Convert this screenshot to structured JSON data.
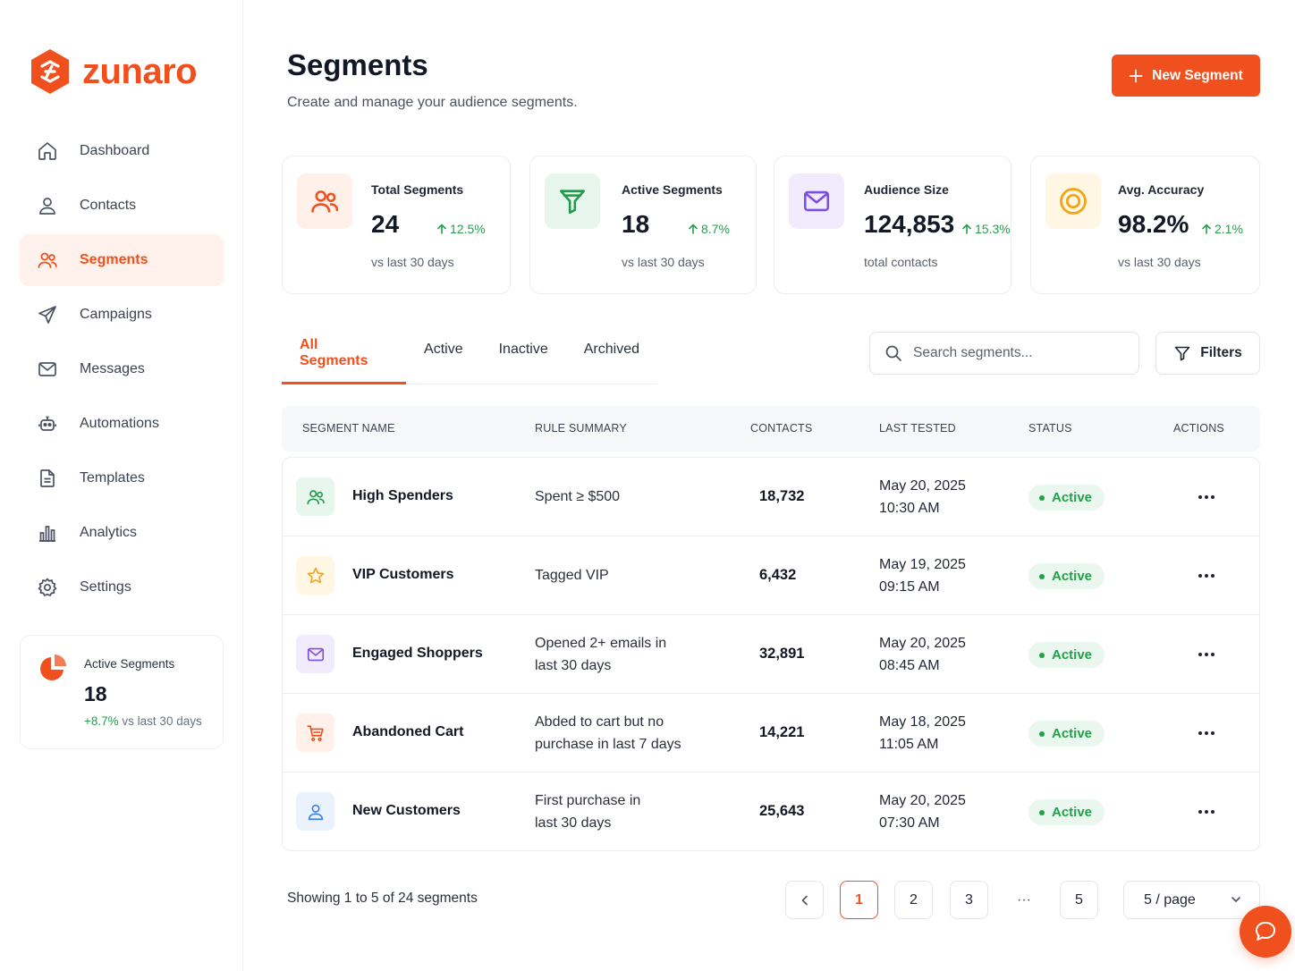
{
  "brand": {
    "name": "zunaro",
    "accent": "#f0501e",
    "logo_icon": "hexagon-logo-icon"
  },
  "sidebar": {
    "items": [
      {
        "label": "Dashboard",
        "icon": "home-icon",
        "active": false
      },
      {
        "label": "Contacts",
        "icon": "user-icon",
        "active": false
      },
      {
        "label": "Segments",
        "icon": "users-icon",
        "active": true
      },
      {
        "label": "Campaigns",
        "icon": "send-icon",
        "active": false
      },
      {
        "label": "Messages",
        "icon": "mail-icon",
        "active": false
      },
      {
        "label": "Automations",
        "icon": "robot-icon",
        "active": false
      },
      {
        "label": "Templates",
        "icon": "document-icon",
        "active": false
      },
      {
        "label": "Analytics",
        "icon": "bar-chart-icon",
        "active": false
      },
      {
        "label": "Settings",
        "icon": "gear-icon",
        "active": false
      }
    ],
    "card": {
      "label": "Active Segments",
      "value": "18",
      "delta": "+8.7%",
      "foot": "vs last 30 days",
      "icon": "pie-chart-icon"
    }
  },
  "header": {
    "title": "Segments",
    "subtitle": "Create and manage your audience segments.",
    "new_button": "New Segment"
  },
  "stats": [
    {
      "label": "Total Segments",
      "value": "24",
      "delta": "12.5%",
      "foot": "vs last 30 days",
      "icon": "users-icon",
      "color": "#f0501e",
      "bg": "#fff0ea"
    },
    {
      "label": "Active Segments",
      "value": "18",
      "delta": "8.7%",
      "foot": "vs last 30 days",
      "icon": "funnel-icon",
      "color": "#1f9a4a",
      "bg": "#e8f7ee"
    },
    {
      "label": "Audience Size",
      "value": "124,853",
      "delta": "15.3%",
      "foot": "total contacts",
      "icon": "mail-icon",
      "color": "#7c4fe0",
      "bg": "#f1ecfd"
    },
    {
      "label": "Avg. Accuracy",
      "value": "98.2%",
      "delta": "2.1%",
      "foot": "vs last 30 days",
      "icon": "target-icon",
      "color": "#f2a516",
      "bg": "#fff6e3"
    }
  ],
  "tabs": [
    "All Segments",
    "Active",
    "Inactive",
    "Archived"
  ],
  "search": {
    "placeholder": "Search segments..."
  },
  "filters_label": "Filters",
  "table": {
    "columns": [
      "SEGMENT NAME",
      "RULE SUMMARY",
      "CONTACTS",
      "LAST TESTED",
      "STATUS",
      "ACTIONS"
    ],
    "rows": [
      {
        "name": "High Spenders",
        "rule": [
          "Spent ≥ $500"
        ],
        "contacts": "18,732",
        "date": "May 20, 2025",
        "time": "10:30 AM",
        "status": "Active",
        "icon": "users-icon",
        "color": "#1f9a4a",
        "bg": "#e8f7ee"
      },
      {
        "name": "VIP Customers",
        "rule": [
          "Tagged VIP"
        ],
        "contacts": "6,432",
        "date": "May 19, 2025",
        "time": "09:15 AM",
        "status": "Active",
        "icon": "star-icon",
        "color": "#f2a516",
        "bg": "#fff6e3"
      },
      {
        "name": "Engaged Shoppers",
        "rule": [
          "Opened 2+ emails in",
          "last 30 days"
        ],
        "contacts": "32,891",
        "date": "May 20, 2025",
        "time": "08:45 AM",
        "status": "Active",
        "icon": "mail-icon",
        "color": "#7c4fe0",
        "bg": "#f1ecfd"
      },
      {
        "name": "Abandoned Cart",
        "rule": [
          "Abded to cart but no",
          "purchase in last 7 days"
        ],
        "contacts": "14,221",
        "date": "May 18, 2025",
        "time": "11:05 AM",
        "status": "Active",
        "icon": "cart-icon",
        "color": "#f0501e",
        "bg": "#fff0ea"
      },
      {
        "name": "New Customers",
        "rule": [
          "First purchase in",
          "last 30 days"
        ],
        "contacts": "25,643",
        "date": "May 20, 2025",
        "time": "07:30 AM",
        "status": "Active",
        "icon": "user-icon",
        "color": "#3b82f6",
        "bg": "#eaf2fe"
      }
    ]
  },
  "pagination": {
    "showing": "Showing 1 to 5 of 24 segments",
    "pages": [
      "1",
      "2",
      "3",
      "5"
    ],
    "current": "1",
    "ellipsis": "···",
    "per_page": "5 / page"
  }
}
